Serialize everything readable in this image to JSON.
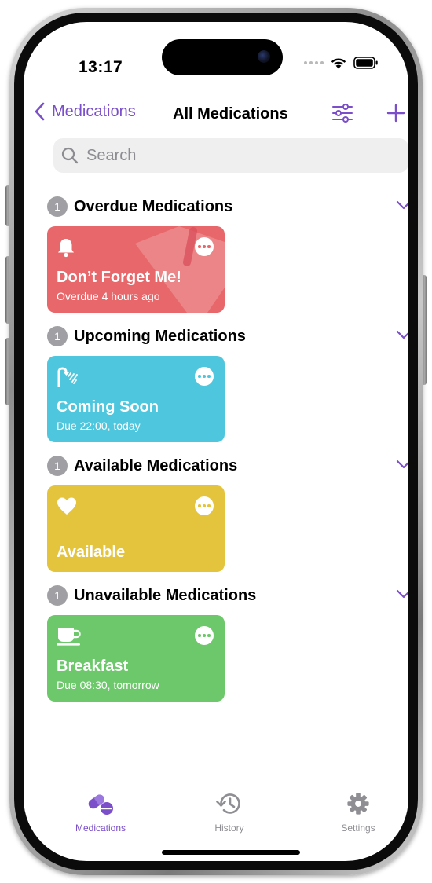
{
  "status_bar": {
    "time": "13:17"
  },
  "nav": {
    "back_label": "Medications",
    "title": "All Medications"
  },
  "search": {
    "placeholder": "Search"
  },
  "sections": [
    {
      "count": "1",
      "title": "Overdue Medications",
      "card": {
        "name": "Don’t Forget Me!",
        "subtitle": "Overdue 4 hours ago",
        "icon": "bell-icon",
        "color": "#e8676a"
      }
    },
    {
      "count": "1",
      "title": "Upcoming Medications",
      "card": {
        "name": "Coming Soon",
        "subtitle": "Due 22:00, today",
        "icon": "shower-icon",
        "color": "#4ec7de"
      }
    },
    {
      "count": "1",
      "title": "Available Medications",
      "card": {
        "name": "Available",
        "subtitle": "",
        "icon": "heart-icon",
        "color": "#e5c43d"
      }
    },
    {
      "count": "1",
      "title": "Unavailable Medications",
      "card": {
        "name": "Breakfast",
        "subtitle": "Due 08:30, tomorrow",
        "icon": "coffee-cup-icon",
        "color": "#6cc86a"
      }
    }
  ],
  "tabs": [
    {
      "label": "Medications",
      "icon": "pills-icon",
      "active": true
    },
    {
      "label": "History",
      "icon": "clock-history-icon",
      "active": false
    },
    {
      "label": "Settings",
      "icon": "gear-icon",
      "active": false
    }
  ],
  "colors": {
    "accent": "#7a4fc9",
    "inactive_tab": "#8e8e93",
    "badge_gray": "#a0a0a4"
  }
}
